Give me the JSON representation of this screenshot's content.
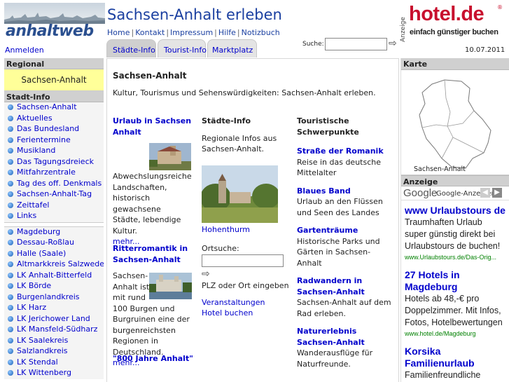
{
  "header": {
    "logo_text": "anhaltweb",
    "site_title": "Sachsen-Anhalt erleben",
    "nav": [
      "Home",
      "Kontakt",
      "Impressum",
      "Hilfe",
      "Notizbuch"
    ],
    "hotel_ad": {
      "label": "Anzeige",
      "brand": "hotel.de",
      "reg": "®",
      "slogan": "einfach günstiger buchen"
    },
    "login": "Anmelden",
    "tabs": [
      "Städte-Info",
      "Tourist-Info",
      "Marktplatz"
    ],
    "search_label": "Suche:",
    "search_value": "",
    "date": "10.07.2011"
  },
  "left": {
    "regional_heading": "Regional",
    "region": "Sachsen-Anhalt",
    "stadtinfo_heading": "Stadt-Info",
    "menu1": [
      "Sachsen-Anhalt",
      "Aktuelles",
      "Das Bundesland",
      "Ferientermine",
      "Musikland",
      "Das Tagungsdreieck",
      "Mitfahrzentrale",
      "Tag des off. Denkmals",
      "Sachsen-Anhalt-Tag",
      "Zeittafel",
      "Links"
    ],
    "menu2": [
      "Magdeburg",
      "Dessau-Roßlau",
      "Halle (Saale)",
      "Altmarkkreis Salzwedel",
      "LK Anhalt-Bitterfeld",
      "LK Börde",
      "Burgenlandkreis",
      "LK Harz",
      "LK Jerichower Land",
      "LK Mansfeld-Südharz",
      "LK Saalekreis",
      "Salzlandkreis",
      "LK Stendal",
      "LK Wittenberg"
    ]
  },
  "main": {
    "title": "Sachsen-Anhalt",
    "intro": "Kultur, Tourismus und Sehenswürdigkeiten: Sachsen-Anhalt erleben.",
    "col1": {
      "a1_title": "Urlaub in Sachsen Anhalt",
      "a1_text": "Abwechslungsreiche Landschaften, historisch gewachsene Städte, lebendige Kultur.",
      "a1_more": "mehr...",
      "a2_title": "Ritterromantik in Sachsen-Anhalt",
      "a2_text": "Sachsen-Anhalt ist mit rund 100 Burgen und Burgruinen eine der burgenreichsten Regionen in Deutschland.",
      "a2_more": "mehr...",
      "a3_title": "\"800 Jahre Anhalt\""
    },
    "col2": {
      "heading": "Städte-Info",
      "text": "Regionale Infos aus Sachsen-Anhalt.",
      "photo_caption": "Hohenthurm",
      "ortsuche_label": "Ortsuche:",
      "ortsuche_value": "",
      "ortsuche_hint": "PLZ oder Ort eingeben",
      "link1": "Veranstaltungen",
      "link2": "Hotel buchen"
    },
    "col3": {
      "heading": "Touristische Schwerpunkte",
      "items": [
        {
          "title": "Straße der Romanik",
          "text": "Reise in das deutsche Mittelalter"
        },
        {
          "title": "Blaues Band",
          "text": "Urlaub an den Flüssen und Seen des Landes"
        },
        {
          "title": "Gartenträume",
          "text": "Historische Parks und Gärten in Sachsen-Anhalt"
        },
        {
          "title": "Radwandern in Sachsen-Anhalt",
          "text": "Sachsen-Anhalt auf dem Rad erleben."
        },
        {
          "title": "Naturerlebnis Sachsen-Anhalt",
          "text": "Wanderausflüge für Naturfreunde."
        }
      ]
    }
  },
  "right": {
    "map_heading": "Karte",
    "map_caption": "Sachsen-Anhalt",
    "ads_heading": "Anzeige",
    "ads_label": "Google-Anzeigen",
    "ads": [
      {
        "title": "www Urlaubstours de",
        "text": "Traumhaften Urlaub super günstig direkt bei Urlaubstours de buchen!",
        "url": "www.Urlaubstours.de/Das-Orig..."
      },
      {
        "title": "27 Hotels in Magdeburg",
        "text": "Hotels ab 48,-€ pro Doppelzimmer. Mit Infos, Fotos, Hotelbewertungen",
        "url": "www.hotel.de/Magdeburg"
      },
      {
        "title": "Korsika Familienurlaub",
        "text": "Familienfreundliche",
        "url": ""
      }
    ]
  }
}
